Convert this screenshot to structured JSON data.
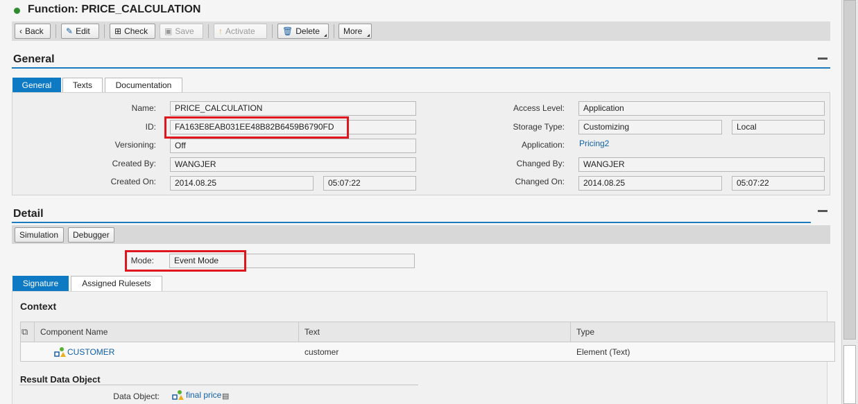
{
  "page": {
    "title": "Function: PRICE_CALCULATION",
    "status_color": "#2e8b2e"
  },
  "toolbar": {
    "back": "Back",
    "edit": "Edit",
    "check": "Check",
    "save": "Save",
    "activate": "Activate",
    "delete": "Delete",
    "more": "More"
  },
  "general": {
    "section_title": "General",
    "tabs": [
      "General",
      "Texts",
      "Documentation"
    ],
    "active_tab": "General",
    "fields": {
      "name_label": "Name:",
      "name_value": "PRICE_CALCULATION",
      "id_label": "ID:",
      "id_value": "FA163E8EAB031EE48B82B6459B6790FD",
      "versioning_label": "Versioning:",
      "versioning_value": "Off",
      "created_by_label": "Created By:",
      "created_by_value": "WANGJER",
      "created_on_label": "Created On:",
      "created_on_date": "2014.08.25",
      "created_on_time": "05:07:22",
      "access_level_label": "Access Level:",
      "access_level_value": "Application",
      "storage_type_label": "Storage Type:",
      "storage_type_value": "Customizing",
      "storage_type_scope": "Local",
      "application_label": "Application:",
      "application_value": "Pricing2",
      "changed_by_label": "Changed By:",
      "changed_by_value": "WANGJER",
      "changed_on_label": "Changed On:",
      "changed_on_date": "2014.08.25",
      "changed_on_time": "05:07:22"
    }
  },
  "detail": {
    "section_title": "Detail",
    "simulation": "Simulation",
    "debugger": "Debugger",
    "mode_label": "Mode:",
    "mode_value": "Event Mode",
    "tabs": [
      "Signature",
      "Assigned Rulesets"
    ],
    "active_tab": "Signature",
    "context_title": "Context",
    "table": {
      "columns": [
        "Component Name",
        "Text",
        "Type"
      ],
      "rows": [
        {
          "component_name": "CUSTOMER",
          "text": "customer",
          "type": "Element (Text)"
        }
      ]
    },
    "result_title": "Result Data Object",
    "data_object_label": "Data Object:",
    "data_object_value": "final price"
  },
  "colors": {
    "accent": "#0e7ac4",
    "highlight": "#e0161f",
    "link": "#1060a8"
  }
}
